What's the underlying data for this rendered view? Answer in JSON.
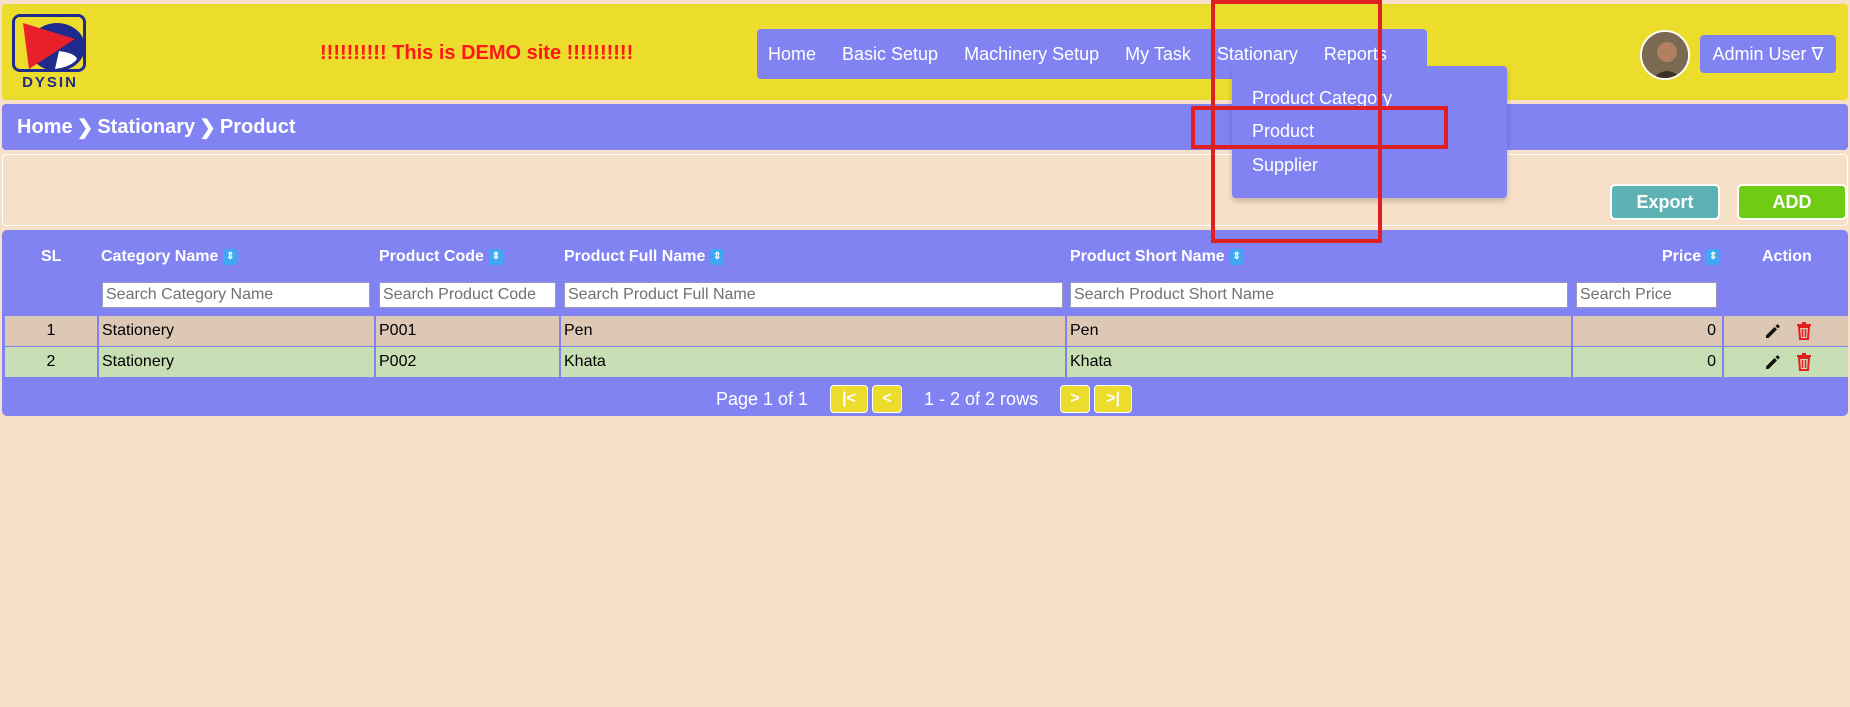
{
  "logo": {
    "text": "DYSIN"
  },
  "banner": {
    "demo_text": "!!!!!!!!!! This is DEMO site !!!!!!!!!!"
  },
  "nav": {
    "items": [
      "Home",
      "Basic Setup",
      "Machinery Setup",
      "My Task",
      "Stationary",
      "Reports"
    ]
  },
  "user": {
    "label": "Admin User ∇"
  },
  "breadcrumb": {
    "items": [
      "Home",
      "Stationary",
      "Product"
    ],
    "separator": "❯"
  },
  "dropdown": {
    "items": [
      "Product Category",
      "Product",
      "Supplier"
    ]
  },
  "toolbar": {
    "export_label": "Export",
    "add_label": "ADD"
  },
  "table": {
    "headers": {
      "sl": "SL",
      "category": "Category Name",
      "code": "Product Code",
      "full_name": "Product Full Name",
      "short_name": "Product Short Name",
      "price": "Price",
      "action": "Action"
    },
    "placeholders": {
      "category": "Search Category Name",
      "code": "Search Product Code",
      "full_name": "Search Product Full Name",
      "short_name": "Search Product Short Name",
      "price": "Search Price"
    },
    "rows": [
      {
        "sl": "1",
        "category": "Stationery",
        "code": "P001",
        "full_name": "Pen",
        "short_name": "Pen",
        "price": "0"
      },
      {
        "sl": "2",
        "category": "Stationery",
        "code": "P002",
        "full_name": "Khata",
        "short_name": "Khata",
        "price": "0"
      }
    ]
  },
  "pager": {
    "page_text": "Page 1 of 1",
    "rows_text": "1 - 2 of 2 rows",
    "first": "|<",
    "prev": "<",
    "next": ">",
    "last": ">|"
  },
  "colors": {
    "header_bg": "#ecdc2c",
    "accent": "#8283f2",
    "page_bg": "#f6e0c8",
    "demo_text": "#ff1616",
    "highlight": "#e02020",
    "export": "#5fb2b4",
    "add": "#6fcc14"
  }
}
